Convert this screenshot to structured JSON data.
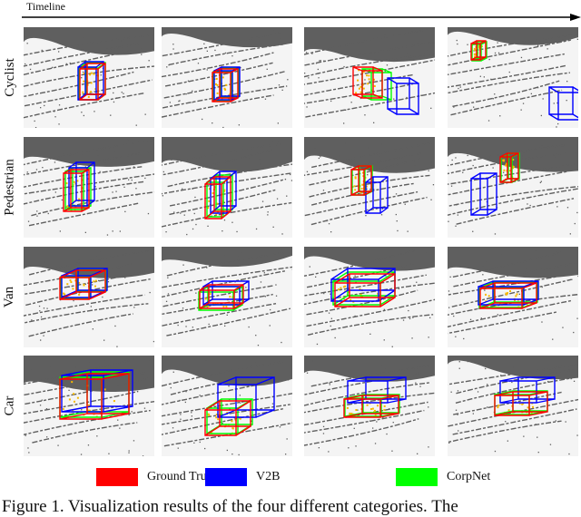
{
  "figure": {
    "timeline_label": "Timeline",
    "rows": [
      {
        "label": "Cyclist"
      },
      {
        "label": "Pedestrian"
      },
      {
        "label": "Van"
      },
      {
        "label": "Car"
      }
    ],
    "columns_per_row": 4,
    "legend": [
      {
        "label": "Ground Truth",
        "color": "#ff0000"
      },
      {
        "label": "V2B",
        "color": "#0000ff"
      },
      {
        "label": "CorpNet",
        "color": "#00ff00"
      }
    ],
    "colors": {
      "background_points": "#5f5f5f",
      "panel_background": "#f4f4f4",
      "target_points": "#f5b800"
    },
    "caption": "Figure 1. Visualization results of the four different categories. The"
  }
}
